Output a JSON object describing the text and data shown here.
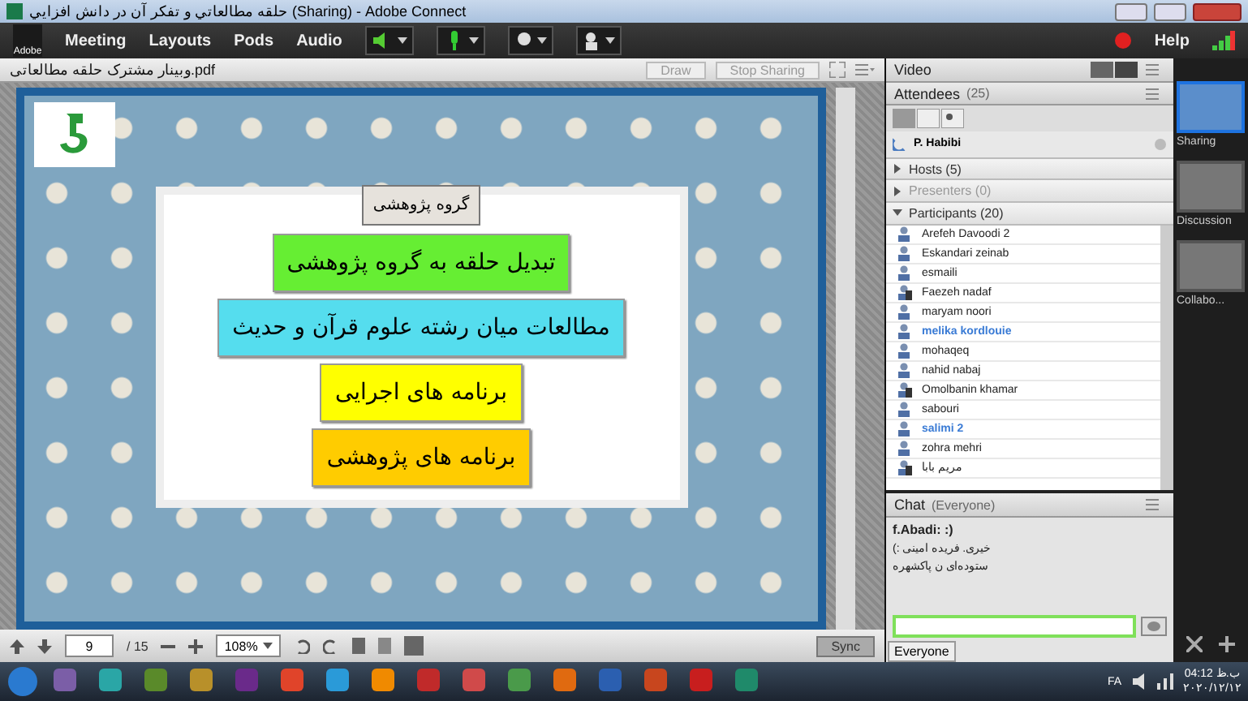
{
  "window": {
    "title": "حلقه مطالعاتي و تفكر آن در دانش افزايي (Sharing) - Adobe Connect"
  },
  "menu": {
    "logo": "Adobe",
    "items": [
      "Meeting",
      "Layouts",
      "Pods",
      "Audio"
    ],
    "help": "Help"
  },
  "share_pod": {
    "title": "وبینار مشترک حلقه مطالعاتی.pdf",
    "buttons": [
      {
        "label": "Draw",
        "disabled": true
      },
      {
        "label": "Stop Sharing",
        "disabled": true
      }
    ],
    "slide": {
      "heading": "گروه پژوهشی",
      "boxes": [
        {
          "text": "تبدیل حلقه به  گروه پژوهشی",
          "color": "#66ee33"
        },
        {
          "text": "مطالعات میان رشته علوم قرآن و حدیث",
          "color": "#55ddee"
        },
        {
          "text": "برنامه های اجرایی",
          "color": "#ffff00"
        },
        {
          "text": "برنامه های پژوهشی",
          "color": "#ffcc00"
        }
      ]
    },
    "toolbar": {
      "page": "9",
      "total": "/ 15",
      "zoom": "108%",
      "sync": "Sync"
    }
  },
  "video_pod": {
    "title": "Video"
  },
  "attendees": {
    "title": "Attendees",
    "count": "(25)",
    "me": "P. Habibi",
    "groups": [
      {
        "label": "Hosts (5)",
        "expanded": false,
        "disabled": false
      },
      {
        "label": "Presenters (0)",
        "expanded": false,
        "disabled": true
      },
      {
        "label": "Participants (20)",
        "expanded": true,
        "disabled": false
      }
    ],
    "participants": [
      {
        "name": "Arefeh Davoodi 2",
        "mobile": false,
        "highlighted": false
      },
      {
        "name": "Eskandari zeinab",
        "mobile": false,
        "highlighted": false
      },
      {
        "name": "esmaili",
        "mobile": false,
        "highlighted": false
      },
      {
        "name": "Faezeh nadaf",
        "mobile": true,
        "highlighted": false
      },
      {
        "name": "maryam noori",
        "mobile": false,
        "highlighted": false
      },
      {
        "name": "melika kordlouie",
        "mobile": false,
        "highlighted": true
      },
      {
        "name": "mohaqeq",
        "mobile": false,
        "highlighted": false
      },
      {
        "name": "nahid nabaj",
        "mobile": false,
        "highlighted": false
      },
      {
        "name": "Omolbanin khamar",
        "mobile": true,
        "highlighted": false
      },
      {
        "name": "sabouri",
        "mobile": false,
        "highlighted": false
      },
      {
        "name": "salimi 2",
        "mobile": false,
        "highlighted": true
      },
      {
        "name": "zohra mehri",
        "mobile": false,
        "highlighted": false
      },
      {
        "name": "مریم بابا",
        "mobile": true,
        "highlighted": false
      }
    ]
  },
  "chat": {
    "title": "Chat",
    "audience": "(Everyone)",
    "messages": [
      {
        "text": "f.Abadi: :)",
        "kind": "author"
      },
      {
        "text": "(: خیری. فریده امینی",
        "kind": "body"
      },
      {
        "text": "ستوده‌ای ن پاکشهره",
        "kind": "body"
      }
    ],
    "tab": "Everyone"
  },
  "layouts": [
    {
      "label": "Sharing",
      "selected": true
    },
    {
      "label": "Discussion",
      "selected": false
    },
    {
      "label": "Collabo...",
      "selected": false
    }
  ],
  "taskbar": {
    "language": "FA",
    "time": "04:12 ب.ظ",
    "date": "۲۰۲۰/۱۲/۱۲"
  }
}
